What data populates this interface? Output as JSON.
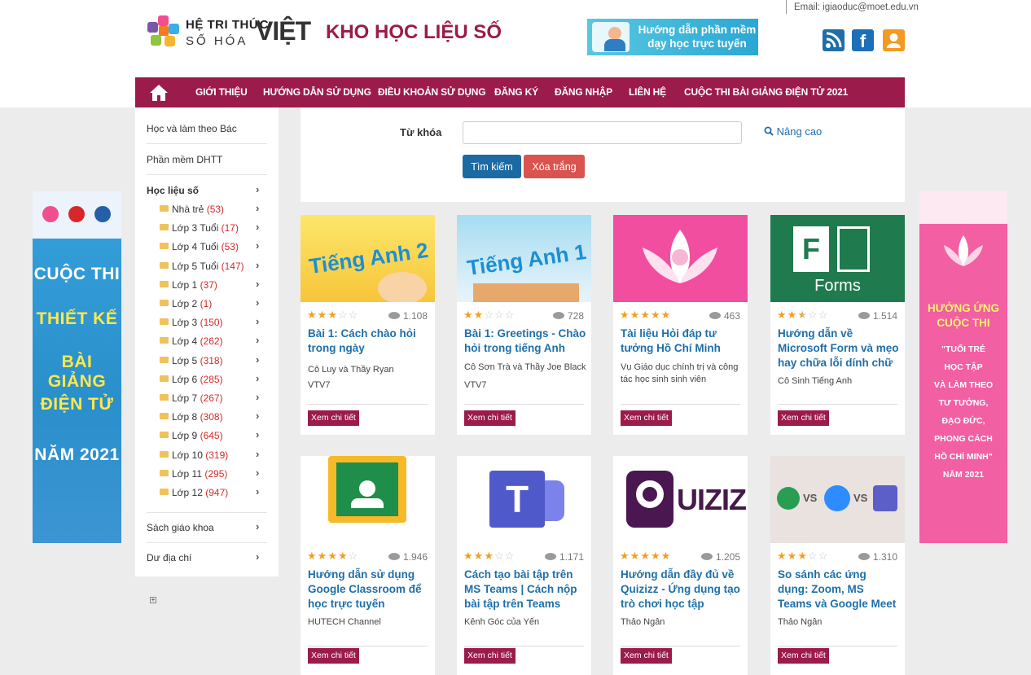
{
  "header": {
    "logo_line1": "HỆ TRI THỨC",
    "logo_line2": "SỐ HÓA",
    "logo_viet": "VIỆT",
    "site_title": "KHO HỌC LIỆU SỐ",
    "guide_banner": "Hướng dẫn phần mềm dạy học trực tuyến",
    "email": "Email: igiaoduc@moet.edu.vn",
    "social_icons": [
      "rss-icon",
      "facebook-icon",
      "user-icon"
    ],
    "fb_letter": "f"
  },
  "nav": {
    "items": [
      "GIỚI THIỆU",
      "HƯỚNG DẪN SỬ DỤNG",
      "ĐIỀU KHOẢN SỬ DỤNG",
      "ĐĂNG KÝ",
      "ĐĂNG NHẬP",
      "LIÊN HỆ",
      "CUỘC THI BÀI GIẢNG ĐIỆN TỬ 2021"
    ]
  },
  "sidebar": {
    "top_items": [
      "Học và làm theo Bác",
      "Phần mềm DHTT"
    ],
    "hoc_lieu_so": "Học liệu số",
    "sub_items": [
      {
        "label": "Nhà trẻ",
        "count": "(53)"
      },
      {
        "label": "Lớp 3 Tuổi",
        "count": "(17)"
      },
      {
        "label": "Lớp 4 Tuổi",
        "count": "(53)"
      },
      {
        "label": "Lớp 5 Tuổi",
        "count": "(147)"
      },
      {
        "label": "Lớp 1",
        "count": "(37)"
      },
      {
        "label": "Lớp 2",
        "count": "(1)"
      },
      {
        "label": "Lớp 3",
        "count": "(150)"
      },
      {
        "label": "Lớp 4",
        "count": "(262)"
      },
      {
        "label": "Lớp 5",
        "count": "(318)"
      },
      {
        "label": "Lớp 6",
        "count": "(285)"
      },
      {
        "label": "Lớp 7",
        "count": "(267)"
      },
      {
        "label": "Lớp 8",
        "count": "(308)"
      },
      {
        "label": "Lớp 9",
        "count": "(645)"
      },
      {
        "label": "Lớp 10",
        "count": "(319)"
      },
      {
        "label": "Lớp 11",
        "count": "(295)"
      },
      {
        "label": "Lớp 12",
        "count": "(947)"
      }
    ],
    "bottom_items": [
      "Sách giáo khoa",
      "Dư địa chí"
    ]
  },
  "search": {
    "label": "Từ khóa",
    "value": "",
    "advanced": "Nâng cao",
    "search_button": "Tìm kiếm",
    "clear_button": "Xóa trắng"
  },
  "left_banner": {
    "lines": [
      "CUỘC THI",
      "THIẾT KẾ",
      "BÀI GIẢNG",
      "ĐIỆN TỬ",
      "NĂM 2021"
    ]
  },
  "right_banner": {
    "title_lines": [
      "HƯỞNG ỨNG",
      "CUỘC THI"
    ],
    "lines": [
      "\"TUỔI TRẺ",
      "HỌC TẬP",
      "VÀ LÀM THEO",
      "TƯ TƯỞNG,",
      "ĐẠO ĐỨC,",
      "PHONG CÁCH",
      "HỒ CHÍ MINH\"",
      "NĂM 2021"
    ]
  },
  "cards": [
    {
      "title": "Bài 1: Cách chào hỏi trong ngày",
      "author": "Cô Luy và Thầy Ryan",
      "source": "VTV7",
      "rating": 3,
      "views": "1.108",
      "thumb_text": "Tiếng Anh 2",
      "detail": "Xem chi tiết"
    },
    {
      "title": "Bài 1: Greetings - Chào hỏi trong tiếng Anh",
      "author": "Cô Sơn Trà và Thầy Joe Black",
      "source": "VTV7",
      "rating": 2,
      "views": "728",
      "thumb_text": "Tiếng Anh 1",
      "detail": "Xem chi tiết"
    },
    {
      "title": "Tài liệu Hỏi đáp tư tưởng Hồ Chí Minh",
      "author": "Vụ Giáo dục chính trị và công tác học sinh sinh viên",
      "source": "",
      "rating": 5,
      "views": "463",
      "thumb_text": "",
      "detail": "Xem chi tiết"
    },
    {
      "title": "Hướng dẫn về Microsoft Form và mẹo hay chữa lỗi dính chữ",
      "author": "Cô Sinh Tiếng Anh",
      "source": "",
      "rating": 2.5,
      "views": "1.514",
      "thumb_text": "Forms",
      "detail": "Xem chi tiết"
    },
    {
      "title": "Hướng dẫn sử dụng Google Classroom để học trực tuyến",
      "author": "HUTECH Channel",
      "source": "",
      "rating": 4,
      "views": "1.946",
      "thumb_text": "",
      "detail": "Xem chi tiết"
    },
    {
      "title": "Cách tạo bài tập trên MS Teams | Cách nộp bài tập trên Teams",
      "author": "Kênh Góc của Yến",
      "source": "",
      "rating": 3,
      "views": "1.171",
      "thumb_text": "T",
      "detail": "Xem chi tiết"
    },
    {
      "title": "Hướng dẫn đầy đủ về Quizizz - Ứng dụng tạo trò chơi học tập",
      "author": "Thảo Ngân",
      "source": "",
      "rating": 5,
      "views": "1.205",
      "thumb_text": "UIZIZ",
      "detail": "Xem chi tiết"
    },
    {
      "title": "So sánh các ứng dụng: Zoom, MS Teams và Google Meet",
      "author": "Thảo Ngân",
      "source": "",
      "rating": 3,
      "views": "1.310",
      "thumb_text": "VS",
      "detail": "Xem chi tiết"
    }
  ],
  "colors": {
    "brand": "#9b1b4a",
    "link": "#1e6fa9",
    "star": "#f0a020",
    "count": "#d42a2a"
  }
}
